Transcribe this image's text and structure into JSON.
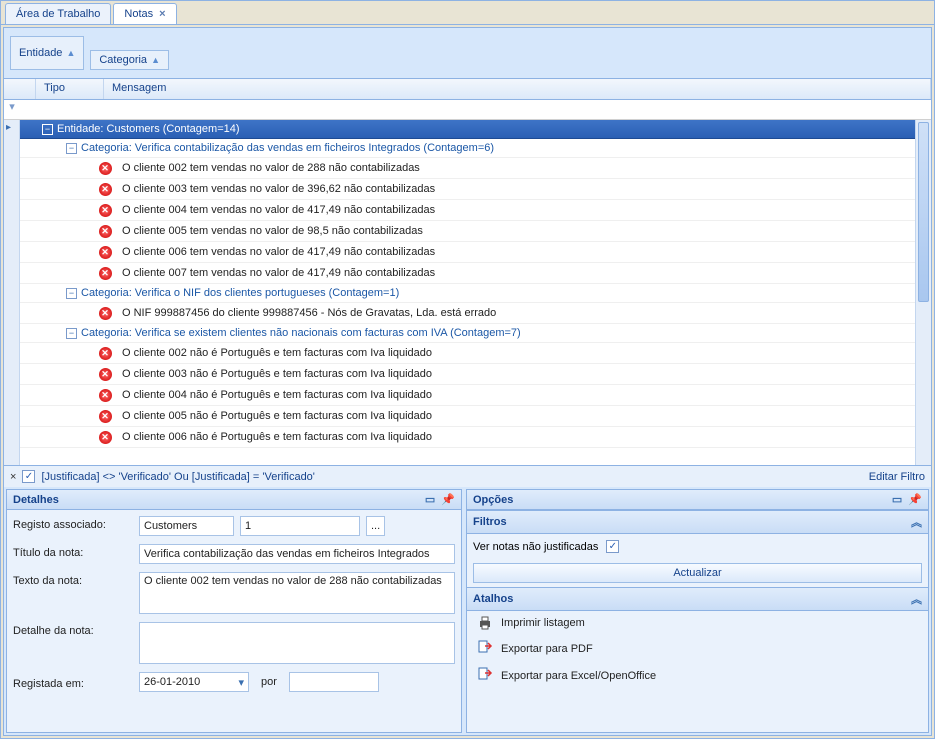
{
  "tabs": [
    {
      "label": "Área de Trabalho",
      "active": false,
      "closable": false
    },
    {
      "label": "Notas",
      "active": true,
      "closable": true
    }
  ],
  "groupby": {
    "entity": "Entidade",
    "category": "Categoria"
  },
  "grid": {
    "columns": {
      "tipo": "Tipo",
      "mensagem": "Mensagem"
    },
    "entity_label": "Entidade: Customers (Contagem=14)",
    "categories": [
      {
        "label": "Categoria: Verifica contabilização das vendas em ficheiros Integrados (Contagem=6)",
        "rows": [
          "O cliente 002 tem vendas no valor de 288 não contabilizadas",
          "O cliente 003 tem vendas no valor de 396,62 não contabilizadas",
          "O cliente 004 tem vendas no valor de 417,49 não contabilizadas",
          "O cliente 005 tem vendas no valor de 98,5 não contabilizadas",
          "O cliente 006 tem vendas no valor de 417,49 não contabilizadas",
          "O cliente 007 tem vendas no valor de 417,49 não contabilizadas"
        ]
      },
      {
        "label": "Categoria: Verifica o NIF dos clientes portugueses (Contagem=1)",
        "rows": [
          "O NIF 999887456 do cliente 999887456 - Nós de Gravatas, Lda. está errado"
        ]
      },
      {
        "label": "Categoria: Verifica se existem clientes não nacionais com facturas com IVA (Contagem=7)",
        "rows": [
          "O cliente 002 não é Português e tem facturas com Iva liquidado",
          "O cliente 003 não é Português e tem facturas com Iva liquidado",
          "O cliente 004 não é Português e tem facturas com Iva liquidado",
          "O cliente 005 não é Português e tem facturas com Iva liquidado",
          "O cliente 006 não é Português e tem facturas com Iva liquidado"
        ]
      }
    ]
  },
  "filterbar": {
    "text": "[Justificada] <> 'Verificado' Ou [Justificada] = 'Verificado'",
    "edit": "Editar Filtro"
  },
  "details": {
    "title": "Detalhes",
    "labels": {
      "registo": "Registo associado:",
      "titulo": "Título da nota:",
      "texto": "Texto da nota:",
      "detalhe": "Detalhe da nota:",
      "registada": "Registada em:",
      "por": "por"
    },
    "values": {
      "entity": "Customers",
      "id": "1",
      "titulo": "Verifica contabilização das vendas em ficheiros Integrados",
      "texto": "O cliente 002 tem vendas no valor de 288 não contabilizadas",
      "detalhe": "",
      "data": "26-01-2010",
      "por": ""
    },
    "browse": "..."
  },
  "options": {
    "title": "Opções",
    "filters_title": "Filtros",
    "ver_nao_just": "Ver notas não justificadas",
    "actualizar": "Actualizar",
    "atalhos_title": "Atalhos",
    "atalhos": {
      "print": "Imprimir listagem",
      "pdf": "Exportar para PDF",
      "excel": "Exportar para Excel/OpenOffice"
    }
  }
}
